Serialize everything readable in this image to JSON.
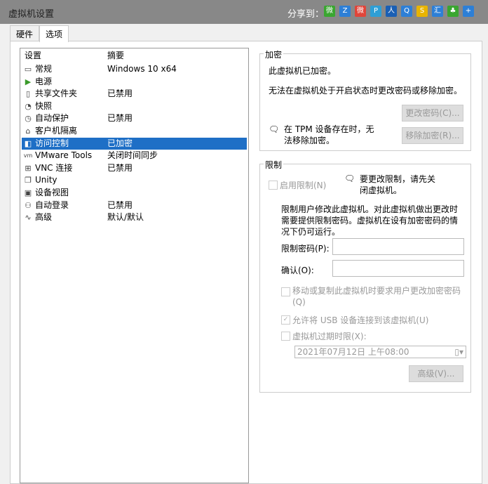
{
  "window": {
    "title": "虚拟机设置",
    "share_label": "分享到："
  },
  "share_icons": [
    {
      "name": "wechat-icon",
      "glyph": "微",
      "color": "#3aa630"
    },
    {
      "name": "qzone-icon",
      "glyph": "Z",
      "color": "#2d7fd6"
    },
    {
      "name": "weibo-icon",
      "glyph": "微",
      "color": "#e0453a"
    },
    {
      "name": "tencent-weibo-icon",
      "glyph": "P",
      "color": "#2e9fd6"
    },
    {
      "name": "renren-icon",
      "glyph": "人",
      "color": "#1a5fb4"
    },
    {
      "name": "qq-icon",
      "glyph": "Q",
      "color": "#2d7fd6"
    },
    {
      "name": "sohu-icon",
      "glyph": "S",
      "color": "#e8b400"
    },
    {
      "name": "huiyou-icon",
      "glyph": "汇",
      "color": "#2d7fd6"
    },
    {
      "name": "kaixin-icon",
      "glyph": "♣",
      "color": "#3aa630"
    },
    {
      "name": "more-icon",
      "glyph": "+",
      "color": "#2d7fd6"
    }
  ],
  "tabs": [
    "硬件",
    "选项"
  ],
  "list": {
    "headers": {
      "setting": "设置",
      "summary": "摘要"
    },
    "items": [
      {
        "icon": "monitor-icon",
        "glyph": "▭",
        "name": "常规",
        "summary": "Windows 10 x64"
      },
      {
        "icon": "power-icon",
        "glyph": "▶",
        "name": "电源",
        "summary": ""
      },
      {
        "icon": "shared-folder-icon",
        "glyph": "▯",
        "name": "共享文件夹",
        "summary": "已禁用"
      },
      {
        "icon": "snapshot-icon",
        "glyph": "◔",
        "name": "快照",
        "summary": ""
      },
      {
        "icon": "autoprotect-icon",
        "glyph": "◷",
        "name": "自动保护",
        "summary": "已禁用"
      },
      {
        "icon": "lock-icon",
        "glyph": "⌂",
        "name": "客户机隔离",
        "summary": ""
      },
      {
        "icon": "access-control-icon",
        "glyph": "◧",
        "name": "访问控制",
        "summary": "已加密"
      },
      {
        "icon": "vmware-tools-icon",
        "glyph": "vm",
        "name": "VMware Tools",
        "summary": "关闭时间同步"
      },
      {
        "icon": "vnc-icon",
        "glyph": "⊞",
        "name": "VNC 连接",
        "summary": "已禁用"
      },
      {
        "icon": "unity-icon",
        "glyph": "❐",
        "name": "Unity",
        "summary": ""
      },
      {
        "icon": "device-view-icon",
        "glyph": "▣",
        "name": "设备视图",
        "summary": ""
      },
      {
        "icon": "autologin-icon",
        "glyph": "⚇",
        "name": "自动登录",
        "summary": "已禁用"
      },
      {
        "icon": "advanced-icon",
        "glyph": "∿",
        "name": "高级",
        "summary": "默认/默认"
      }
    ]
  },
  "encryption": {
    "label": "加密",
    "status": "此虚拟机已加密。",
    "note": "无法在虚拟机处于开启状态时更改密码或移除加密。",
    "change_pw": "更改密码(C)...",
    "remove": "移除加密(R)...",
    "tpm_note": "在 TPM 设备存在时，无法移除加密。"
  },
  "restrictions": {
    "label": "限制",
    "enable": "启用限制(N)",
    "power_note": "要更改限制，请先关闭虚拟机。",
    "desc": "限制用户修改此虚拟机。对此虚拟机做出更改时需要提供限制密码。虚拟机在设有加密密码的情况下仍可运行。",
    "pw_label": "限制密码(P):",
    "confirm_label": "确认(O):",
    "move_copy": "移动或复制此虚拟机时要求用户更改加密密码(Q)",
    "usb": "允许将 USB 设备连接到该虚拟机(U)",
    "expire": "虚拟机过期时限(X):",
    "date": "2021年07月12日 上午08:00",
    "advanced": "高级(V)..."
  }
}
